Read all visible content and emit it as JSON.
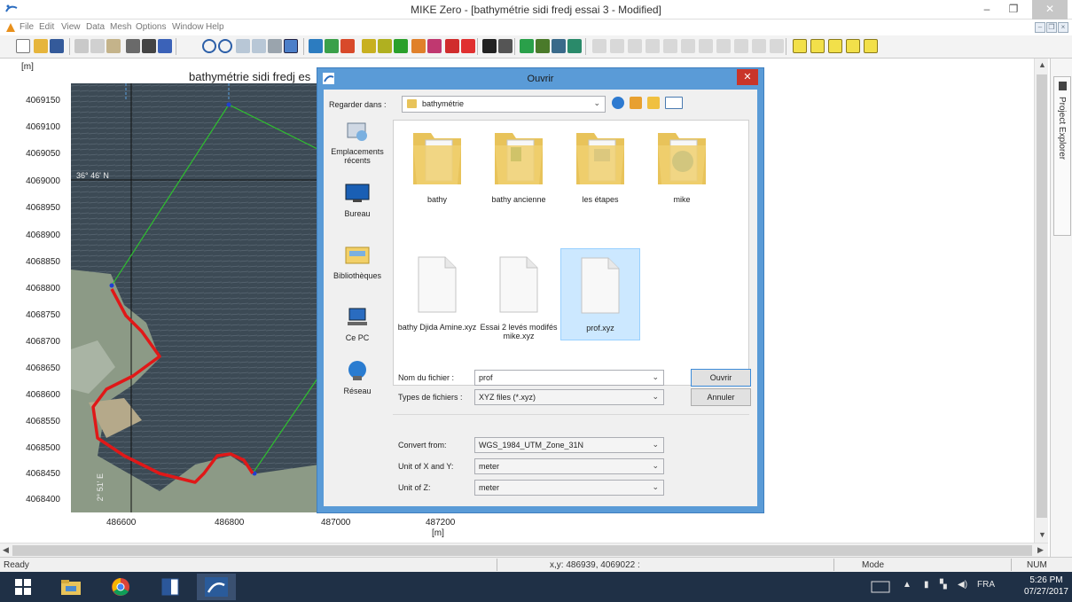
{
  "window": {
    "title": "MIKE Zero - [bathymétrie sidi fredj essai 3 - Modified]",
    "minimize": "–",
    "restore": "❐",
    "close": "✕"
  },
  "menu": {
    "items": [
      "File",
      "Edit",
      "View",
      "Data",
      "Mesh",
      "Options",
      "Window",
      "Help"
    ]
  },
  "plot": {
    "title": "bathymétrie sidi fredj es",
    "y_unit": "[m]",
    "x_unit": "[m]",
    "y_ticks": [
      "4069150",
      "4069100",
      "4069050",
      "4069000",
      "4068950",
      "4068900",
      "4068850",
      "4068800",
      "4068750",
      "4068700",
      "4068650",
      "4068600",
      "4068550",
      "4068500",
      "4068450",
      "4068400"
    ],
    "x_ticks": [
      "486600",
      "486800",
      "487000",
      "487200"
    ],
    "lat_label": "36° 46' N",
    "lon_label": "2° 51' E"
  },
  "dialog": {
    "title": "Ouvrir",
    "look_in_label": "Regarder dans :",
    "look_in_value": "bathymétrie",
    "places": [
      "Emplacements récents",
      "Bureau",
      "Bibliothèques",
      "Ce PC",
      "Réseau"
    ],
    "folders": [
      "bathy",
      "bathy ancienne",
      "les étapes",
      "mike"
    ],
    "files": [
      "bathy Djida Amine.xyz",
      "Essai 2 levés modifés mike.xyz",
      "prof.xyz"
    ],
    "filename_label": "Nom du fichier :",
    "filename_value": "prof",
    "filetype_label": "Types de fichiers :",
    "filetype_value": "XYZ files (*.xyz)",
    "open_button": "Ouvrir",
    "cancel_button": "Annuler",
    "convert_label": "Convert from:",
    "convert_value": "WGS_1984_UTM_Zone_31N",
    "unit_xy_label": "Unit of X and Y:",
    "unit_xy_value": "meter",
    "unit_z_label": "Unit of Z:",
    "unit_z_value": "meter"
  },
  "side_panel": {
    "tab_label": "Project Explorer"
  },
  "status": {
    "ready": "Ready",
    "coords": "x,y: 486939, 4069022 :",
    "mode": "Mode",
    "num": "NUM"
  },
  "taskbar": {
    "lang": "FRA",
    "time": "5:26 PM",
    "date": "07/27/2017"
  },
  "colors": {
    "dialog_frame": "#5a9bd7",
    "close_red": "#c9352a",
    "taskbar": "#1f3046",
    "coastline": "#e01818",
    "boundary": "#2ec02e"
  }
}
